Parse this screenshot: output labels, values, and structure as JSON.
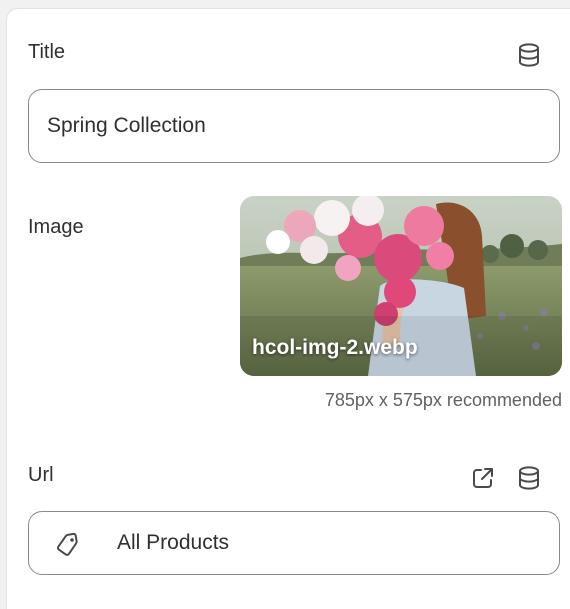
{
  "title_field": {
    "label": "Title",
    "value": "Spring Collection",
    "source_icon": "database-icon"
  },
  "image_field": {
    "label": "Image",
    "file_name": "hcol-img-2.webp",
    "hint": "785px x 575px recommended"
  },
  "url_field": {
    "label": "Url",
    "value": "All Products",
    "value_icon": "tag-icon",
    "open_icon": "external-link-icon",
    "source_icon": "database-icon"
  }
}
